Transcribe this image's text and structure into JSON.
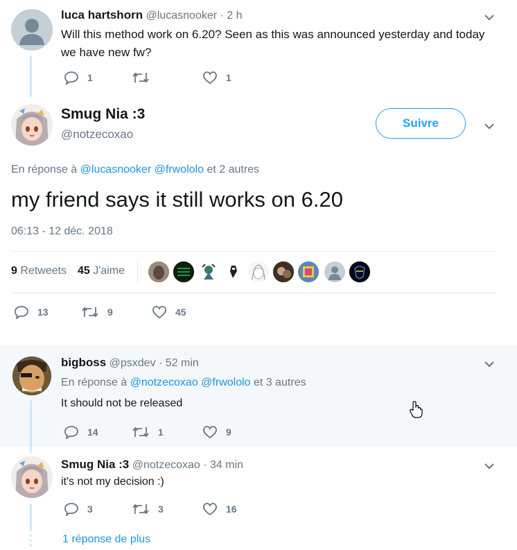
{
  "tweet1": {
    "name": "luca hartshorn",
    "handle": "@lucasnooker",
    "time": "· 2 h",
    "text_line1": "Will this method work on 6.20? Seen as this was announced yesterday and today",
    "text_line2": "we have new fw?",
    "replies": "1",
    "retweets": "",
    "likes": "1"
  },
  "main": {
    "name": "Smug Nia :3",
    "handle": "@notzecoxao",
    "follow_label": "Suivre",
    "reply_prefix": "En réponse à",
    "reply_to1": "@lucasnooker",
    "reply_to2": "@frwololo",
    "reply_suffix": "et 2 autres",
    "text": "my friend says it still works on 6.20",
    "datetime": "06:13 - 12 déc. 2018",
    "retweet_count": "9",
    "retweet_label": "Retweets",
    "like_count": "45",
    "like_label": "J'aime",
    "replies": "13",
    "retweets": "9",
    "likes": "45"
  },
  "tweet3": {
    "name": "bigboss",
    "handle": "@psxdev",
    "time": "· 52 min",
    "reply_prefix": "En réponse à",
    "reply_to1": "@notzecoxao",
    "reply_to2": "@frwololo",
    "reply_suffix": "et 3 autres",
    "text": "It should not be released",
    "replies": "14",
    "retweets": "1",
    "likes": "9"
  },
  "tweet4": {
    "name": "Smug Nia :3",
    "handle": "@notzecoxao",
    "time": "· 34 min",
    "text": "it's not my decision :)",
    "replies": "3",
    "retweets": "3",
    "likes": "16"
  },
  "more_replies": "1 réponse de plus",
  "colors": {
    "accent": "#1da1f2",
    "link": "#1b95e0",
    "muted": "#657786",
    "thread": "#cce8f8",
    "highlight": "#f5f8fa"
  }
}
